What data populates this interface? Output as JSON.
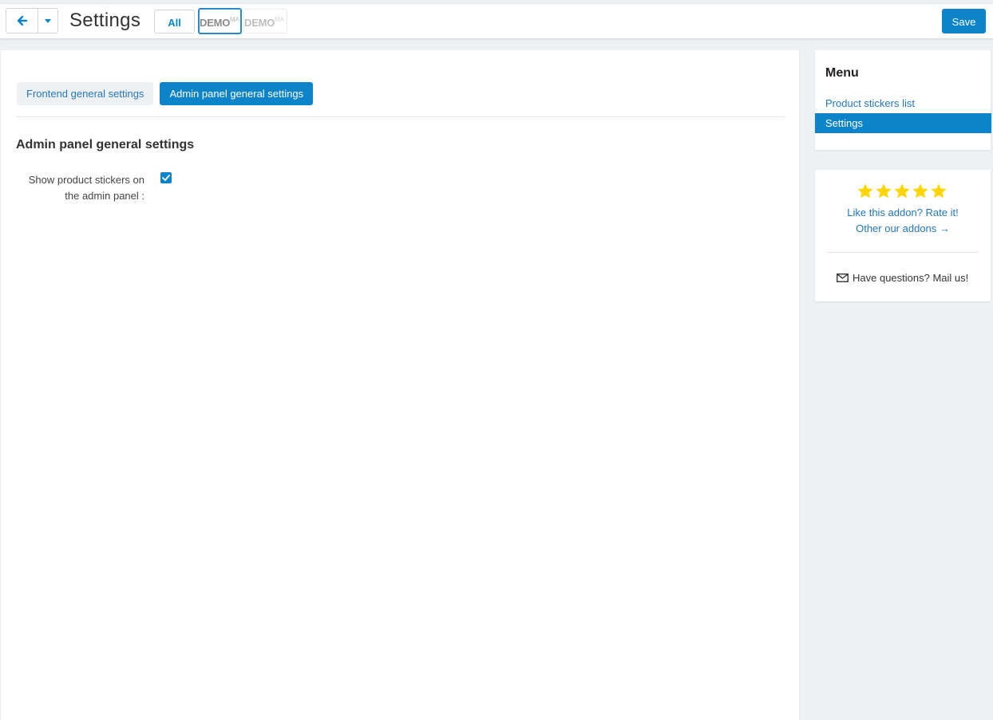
{
  "header": {
    "title": "Settings",
    "lang_all_label": "All",
    "storefronts": [
      {
        "logo_main": "DEMO",
        "logo_sub": "MA"
      },
      {
        "logo_main": "DEMO",
        "logo_sub": "MA"
      }
    ],
    "save_label": "Save"
  },
  "tabs": [
    {
      "label": "Frontend general settings",
      "active": false
    },
    {
      "label": "Admin panel general settings",
      "active": true
    }
  ],
  "section": {
    "title": "Admin panel general settings",
    "fields": [
      {
        "label": "Show product stickers on the admin panel :",
        "checked": true
      }
    ]
  },
  "sidebar": {
    "menu_title": "Menu",
    "items": [
      {
        "label": "Product stickers list",
        "active": false
      },
      {
        "label": "Settings",
        "active": true
      }
    ],
    "rating": {
      "stars": 5,
      "rate_label": "Like this addon? Rate it!",
      "other_label": "Other our addons →",
      "mail_label": "Have questions? Mail us!"
    }
  },
  "colors": {
    "accent": "#0d84c9",
    "link": "#2478b8",
    "star": "#ffd500",
    "background": "#edf1f4"
  },
  "icons": {
    "back": "arrow-left-icon",
    "caret": "caret-down-icon",
    "check": "check-icon",
    "star": "star-icon",
    "mail": "envelope-icon"
  }
}
